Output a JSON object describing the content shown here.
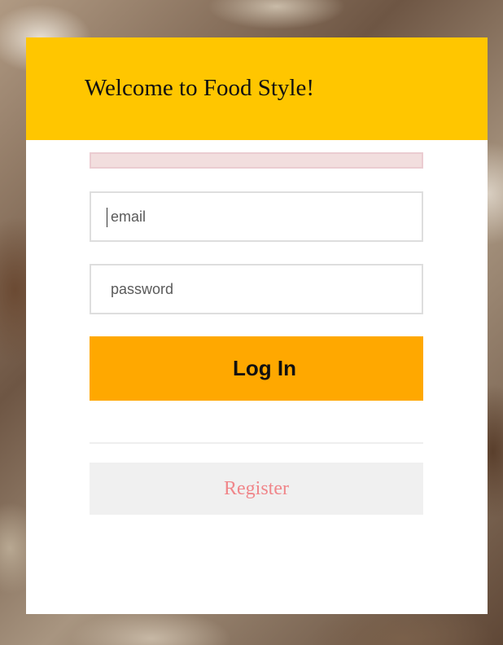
{
  "header": {
    "title": "Welcome to Food Style!"
  },
  "form": {
    "error_message": "",
    "email": {
      "value": "",
      "placeholder": "email"
    },
    "password": {
      "value": "",
      "placeholder": "password"
    },
    "login_label": "Log In",
    "register_label": "Register"
  },
  "colors": {
    "header_background": "#ffc600",
    "login_button": "#ffa800",
    "register_text": "#f0868a",
    "register_background": "#f0f0f0",
    "error_background": "#f2dede",
    "error_border": "#ebccd1"
  }
}
